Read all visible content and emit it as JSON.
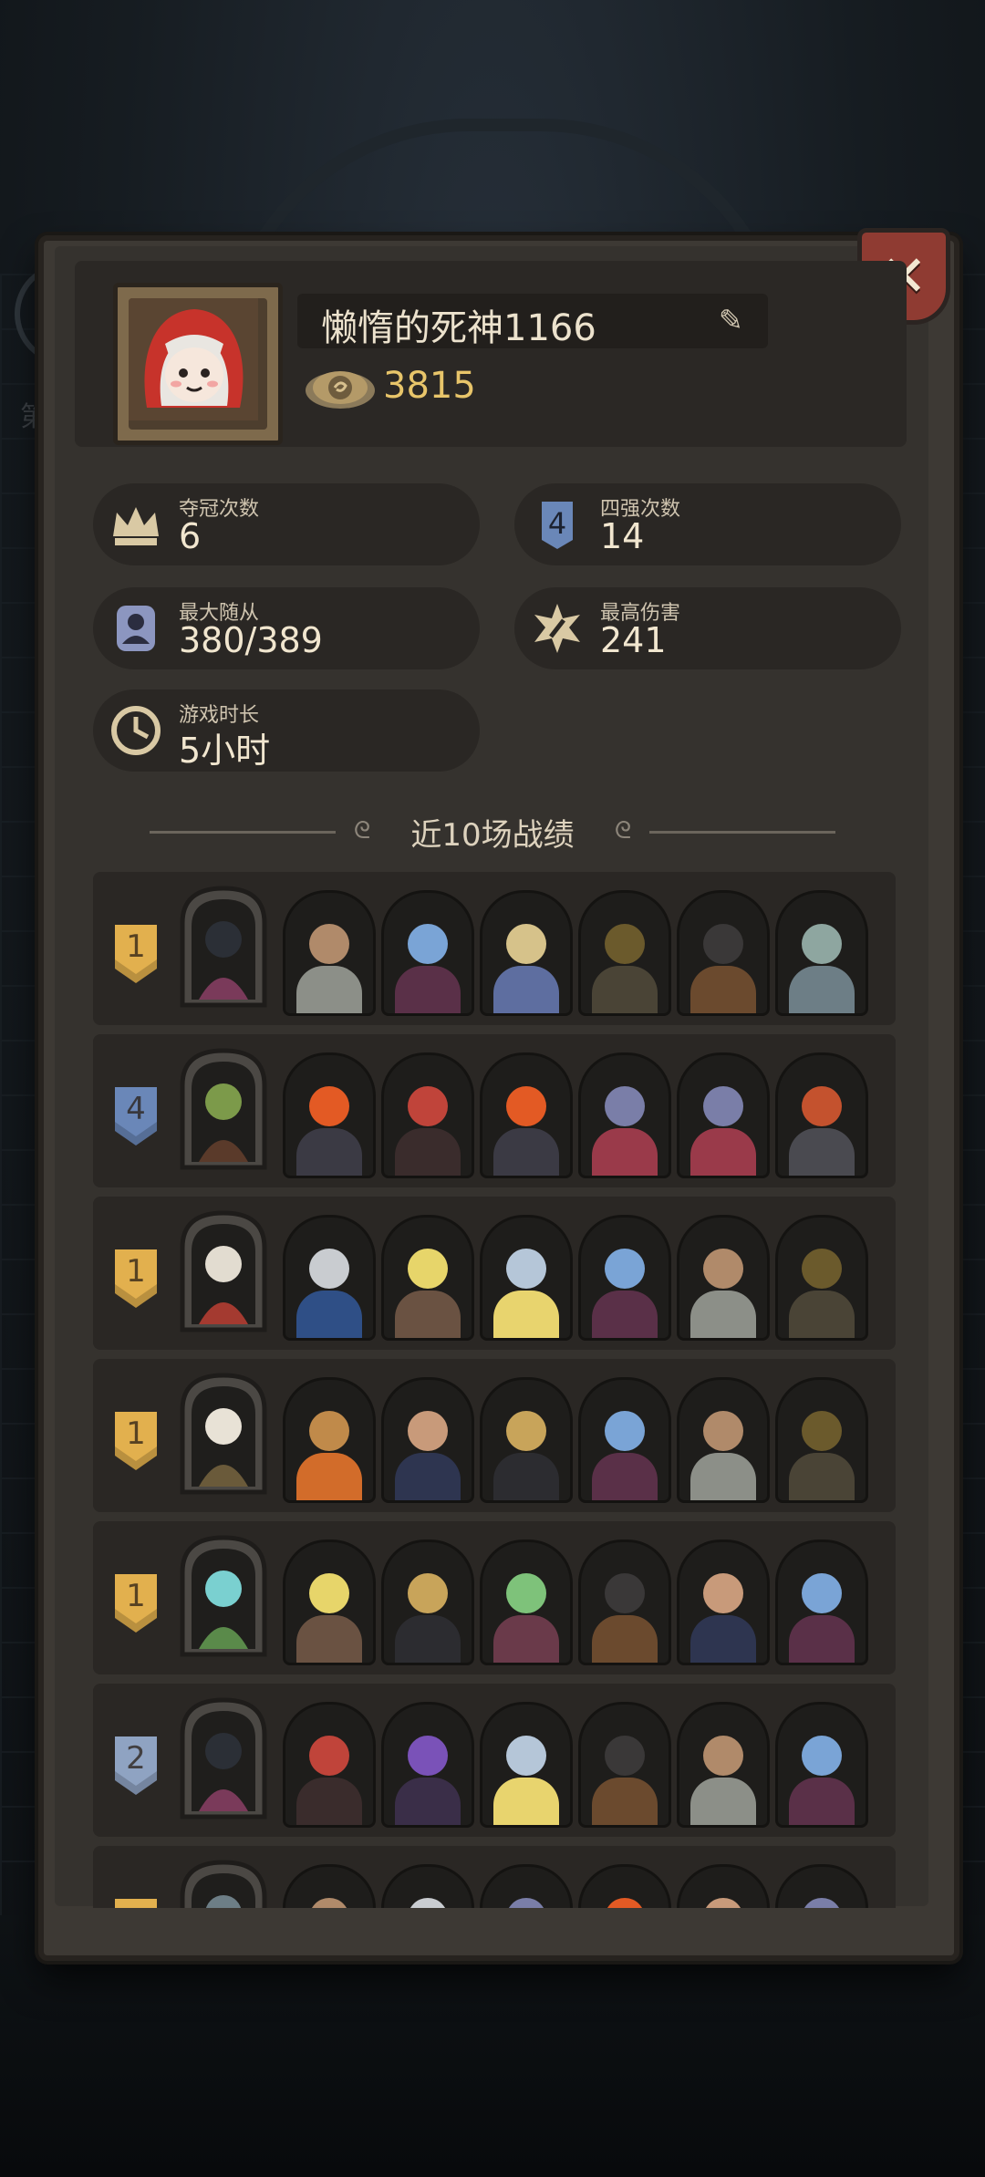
{
  "background": {
    "side_text": "第"
  },
  "close_button": {
    "icon": "close-icon"
  },
  "profile": {
    "name": "懒惰的死神1166",
    "coins": "3815"
  },
  "stats": [
    {
      "label": "夺冠次数",
      "value": "6",
      "icon": "crown-icon"
    },
    {
      "label": "四强次数",
      "value": "14",
      "icon": "top4-icon"
    },
    {
      "label": "最大随从",
      "value": "380/389",
      "icon": "minion-icon"
    },
    {
      "label": "最高伤害",
      "value": "241",
      "icon": "damage-icon"
    },
    {
      "label": "游戏时长",
      "value": "5小时",
      "icon": "clock-icon"
    }
  ],
  "section_title": "近10场战绩",
  "matches": [
    {
      "place": "1",
      "hero": "black-cat-hero",
      "units": [
        "bearded-warrior",
        "elf-sorceress",
        "golden-knight",
        "witch-hat-mage",
        "shield-brute",
        "gargoyle"
      ]
    },
    {
      "place": "4",
      "hero": "plant-hero",
      "units": [
        "fire-boar",
        "hooded-assassin",
        "fire-boar",
        "rat-rogue",
        "rat-rogue",
        "red-golem"
      ]
    },
    {
      "place": "1",
      "hero": "gnome-elder-hero",
      "units": [
        "armored-knight",
        "pig-warrior",
        "holy-shield",
        "elf-sorceress",
        "bearded-warrior",
        "witch-hat-mage"
      ]
    },
    {
      "place": "1",
      "hero": "bearded-sage-hero",
      "units": [
        "bear-cub",
        "mustache-gentleman",
        "winged-demon",
        "elf-sorceress",
        "bearded-warrior",
        "witch-hat-mage"
      ]
    },
    {
      "place": "1",
      "hero": "fairy-queen-hero",
      "units": [
        "pig-warrior",
        "winged-demon",
        "skeleton-druid",
        "shield-brute",
        "mustache-gentleman",
        "elf-sorceress"
      ]
    },
    {
      "place": "2",
      "hero": "black-cat-hero",
      "units": [
        "hooded-assassin",
        "purple-dragon",
        "holy-shield",
        "shield-brute",
        "bearded-warrior",
        "elf-sorceress"
      ]
    },
    {
      "place": "",
      "hero": "gargoyle-hero",
      "units": [
        "bearded-warrior",
        "armored-knight",
        "rat-rogue",
        "fire-boar",
        "mustache-gentleman",
        "rat-rogue"
      ]
    }
  ],
  "colors": {
    "panel": "#3d3934",
    "row": "#2a2724",
    "gold_badge": "#e2b04e",
    "blue_badge": "#6a87b8",
    "silver_badge": "#8fa3c2",
    "coin_text": "#e8c56a",
    "close_button": "#8f3b32"
  }
}
